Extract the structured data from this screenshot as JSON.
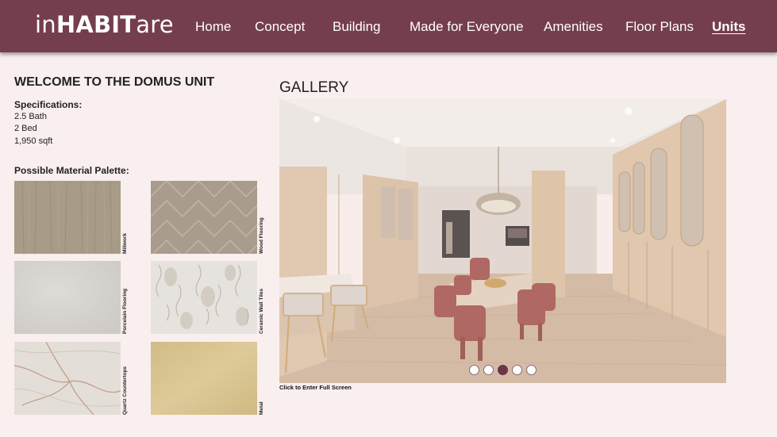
{
  "nav": {
    "logo_light_1": "in",
    "logo_bold": "HABIT",
    "logo_light_2": "are",
    "items": [
      {
        "label": "Home"
      },
      {
        "label": "Concept"
      },
      {
        "label": "Building"
      },
      {
        "label": "Made for Everyone"
      },
      {
        "label": "Amenities"
      },
      {
        "label": "Floor Plans"
      },
      {
        "label": "Units",
        "active": true
      }
    ]
  },
  "unit": {
    "title": "WELCOME TO THE DOMUS UNIT",
    "spec_title": "Specifications:",
    "specs": [
      "2.5 Bath",
      "2 Bed",
      "1,950 sqft"
    ],
    "palette_title": "Possible Material Palette:"
  },
  "materials": [
    {
      "label": "Millwork",
      "color": "#a89b87"
    },
    {
      "label": "Wood Flooring",
      "color": "#a99c8d"
    },
    {
      "label": "Porcelain Flooring",
      "color": "#d6d3d0"
    },
    {
      "label": "Ceramic Wall Tiles",
      "color": "#e2dfd9"
    },
    {
      "label": "Quartz Countertops",
      "color": "#e4ded8"
    },
    {
      "label": "Metal",
      "color": "#d8c48f"
    }
  ],
  "gallery": {
    "title": "GALLERY",
    "fullscreen_label": "Click to Enter Full Screen",
    "slide_count": 5,
    "active_slide": 3
  },
  "colors": {
    "brand": "#753e4d",
    "background": "#f9efee",
    "active_dot": "#6d3548"
  }
}
